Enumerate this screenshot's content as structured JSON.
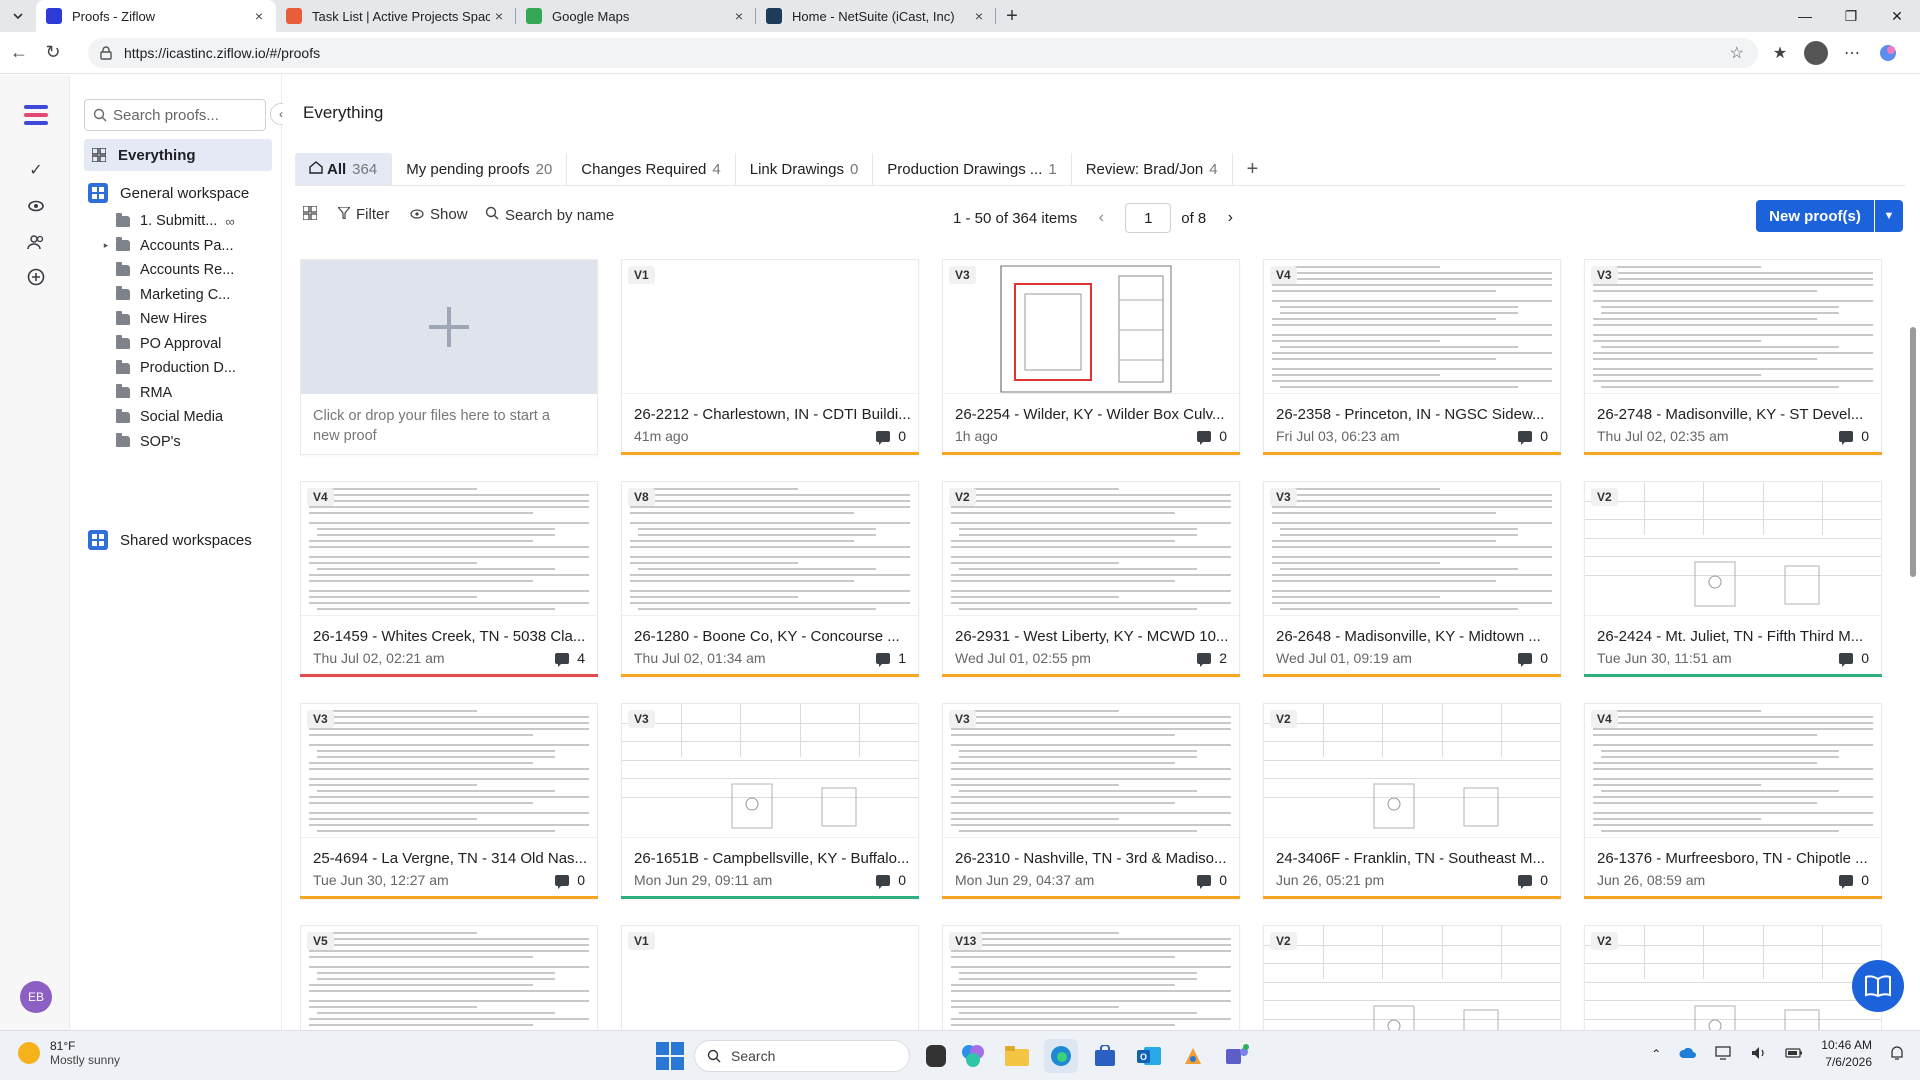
{
  "browser": {
    "tabs": [
      {
        "title": "Proofs - Ziflow",
        "favicon_color": "#2e3bd6",
        "active": true
      },
      {
        "title": "Task List | Active Projects Space | ",
        "favicon_color": "#e85d3a",
        "active": false
      },
      {
        "title": "Google Maps",
        "favicon_color": "#34a853",
        "active": false
      },
      {
        "title": "Home - NetSuite (iCast, Inc)",
        "favicon_color": "#1f3b5c",
        "active": false
      }
    ],
    "url": "https://icastinc.ziflow.io/#/proofs"
  },
  "rail": {
    "user_initials": "EB",
    "user_color": "#8c5fc4"
  },
  "sidebar": {
    "search_placeholder": "Search proofs...",
    "everything_label": "Everything",
    "general_workspace": "General workspace",
    "folders": [
      {
        "label": "1. Submitt...",
        "linked": true,
        "expandable": false
      },
      {
        "label": "Accounts Pa...",
        "linked": false,
        "expandable": true
      },
      {
        "label": "Accounts Re...",
        "linked": false,
        "expandable": false
      },
      {
        "label": "Marketing C...",
        "linked": false,
        "expandable": false
      },
      {
        "label": "New Hires",
        "linked": false,
        "expandable": false
      },
      {
        "label": "PO Approval",
        "linked": false,
        "expandable": false
      },
      {
        "label": "Production D...",
        "linked": false,
        "expandable": false
      },
      {
        "label": "RMA",
        "linked": false,
        "expandable": false
      },
      {
        "label": "Social Media",
        "linked": false,
        "expandable": false
      },
      {
        "label": "SOP's",
        "linked": false,
        "expandable": false
      }
    ],
    "shared_workspaces": "Shared workspaces"
  },
  "main": {
    "title": "Everything",
    "tabs": [
      {
        "label": "All",
        "count": "364",
        "active": true
      },
      {
        "label": "My pending proofs",
        "count": "20"
      },
      {
        "label": "Changes Required",
        "count": "4"
      },
      {
        "label": "Link Drawings",
        "count": "0"
      },
      {
        "label": "Production Drawings ...",
        "count": "1"
      },
      {
        "label": "Review: Brad/Jon",
        "count": "4"
      }
    ],
    "toolbar": {
      "filter": "Filter",
      "show": "Show",
      "search": "Search by name",
      "range": "1 - 50 of 364 items",
      "page": "1",
      "of_pages": "of 8",
      "new_proof": "New proof(s)"
    },
    "upload_hint": "Click or drop your files here to start a new proof",
    "status_colors": {
      "orange": "#f5a623",
      "red": "#e5484d",
      "green": "#2eaf7d"
    },
    "proofs": [
      {
        "version": "V1",
        "name": "26-2212 - Charlestown, IN - CDTI Buildi...",
        "date": "41m ago",
        "comments": "0",
        "status": "orange",
        "thumb": "blank"
      },
      {
        "version": "V3",
        "name": "26-2254 - Wilder, KY - Wilder Box Culv...",
        "date": "1h ago",
        "comments": "0",
        "status": "orange",
        "thumb": "drawing"
      },
      {
        "version": "V4",
        "name": "26-2358 - Princeton, IN - NGSC Sidew...",
        "date": "Fri Jul 03, 06:23 am",
        "comments": "0",
        "status": "orange",
        "thumb": "doc"
      },
      {
        "version": "V3",
        "name": "26-2748 - Madisonville, KY - ST Devel...",
        "date": "Thu Jul 02, 02:35 am",
        "comments": "0",
        "status": "orange",
        "thumb": "doc"
      },
      {
        "version": "V4",
        "name": "26-1459 - Whites Creek, TN - 5038 Cla...",
        "date": "Thu Jul 02, 02:21 am",
        "comments": "4",
        "status": "red",
        "thumb": "doc"
      },
      {
        "version": "V8",
        "name": "26-1280 - Boone Co, KY - Concourse ...",
        "date": "Thu Jul 02, 01:34 am",
        "comments": "1",
        "status": "orange",
        "thumb": "doc"
      },
      {
        "version": "V2",
        "name": "26-2931 - West Liberty, KY - MCWD 10...",
        "date": "Wed Jul 01, 02:55 pm",
        "comments": "2",
        "status": "orange",
        "thumb": "doc"
      },
      {
        "version": "V3",
        "name": "26-2648 - Madisonville, KY - Midtown ...",
        "date": "Wed Jul 01, 09:19 am",
        "comments": "0",
        "status": "orange",
        "thumb": "doc"
      },
      {
        "version": "V2",
        "name": "26-2424 - Mt. Juliet, TN - Fifth Third M...",
        "date": "Tue Jun 30, 11:51 am",
        "comments": "0",
        "status": "green",
        "thumb": "table"
      },
      {
        "version": "V3",
        "name": "25-4694 - La Vergne, TN - 314 Old Nas...",
        "date": "Tue Jun 30, 12:27 am",
        "comments": "0",
        "status": "orange",
        "thumb": "doc"
      },
      {
        "version": "V3",
        "name": "26-1651B - Campbellsville, KY - Buffalo...",
        "date": "Mon Jun 29, 09:11 am",
        "comments": "0",
        "status": "green",
        "thumb": "table"
      },
      {
        "version": "V3",
        "name": "26-2310 - Nashville, TN - 3rd & Madiso...",
        "date": "Mon Jun 29, 04:37 am",
        "comments": "0",
        "status": "orange",
        "thumb": "doc"
      },
      {
        "version": "V2",
        "name": "24-3406F - Franklin, TN - Southeast M...",
        "date": "Jun 26, 05:21 pm",
        "comments": "0",
        "status": "orange",
        "thumb": "table"
      },
      {
        "version": "V4",
        "name": "26-1376 - Murfreesboro, TN - Chipotle ...",
        "date": "Jun 26, 08:59 am",
        "comments": "0",
        "status": "orange",
        "thumb": "doc"
      },
      {
        "version": "V5",
        "name": "",
        "date": "",
        "comments": "",
        "status": "none",
        "thumb": "doc"
      },
      {
        "version": "V1",
        "name": "",
        "date": "",
        "comments": "",
        "status": "none",
        "thumb": "blank"
      },
      {
        "version": "V13",
        "name": "",
        "date": "",
        "comments": "",
        "status": "none",
        "thumb": "doc"
      },
      {
        "version": "V2",
        "name": "",
        "date": "",
        "comments": "",
        "status": "none",
        "thumb": "table"
      },
      {
        "version": "V2",
        "name": "",
        "date": "",
        "comments": "",
        "status": "none",
        "thumb": "table"
      }
    ]
  },
  "taskbar": {
    "temp": "81°F",
    "condition": "Mostly sunny",
    "search": "Search",
    "time": "10:46 AM",
    "date": "7/6/2026"
  }
}
